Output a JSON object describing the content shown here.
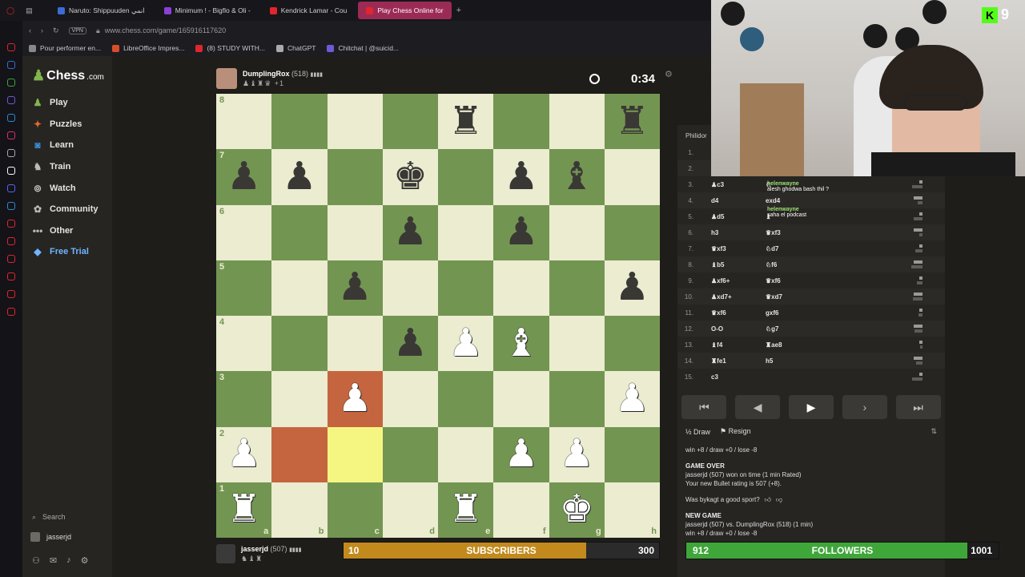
{
  "browser": {
    "tabs": [
      {
        "label": "Naruto: Shippuuden انمي",
        "color": "#3b6bd6"
      },
      {
        "label": "Minimum ! - Bigflo & Oli -",
        "color": "#8b3fd9"
      },
      {
        "label": "Kendrick Lamar - Cou",
        "color": "#e0262d"
      },
      {
        "label": "Play Chess Online for",
        "color": "#e0262d",
        "active": true
      }
    ],
    "vpn": "VPN",
    "url": "www.chess.com/game/165916117620",
    "bookmarks": [
      {
        "label": "Pour performer en...",
        "color": "#888"
      },
      {
        "label": "LibreOffice Impres...",
        "color": "#d94e2a"
      },
      {
        "label": "(8) STUDY WITH...",
        "color": "#e0262d"
      },
      {
        "label": "ChatGPT",
        "color": "#aaa"
      },
      {
        "label": "Chitchat | @suicid...",
        "color": "#6c5bd6"
      }
    ]
  },
  "sidebar": {
    "brand": "Chess",
    "brand_domain": ".com",
    "items": [
      {
        "label": "Play",
        "icon": "pawn-icon",
        "glyph": "♟"
      },
      {
        "label": "Puzzles",
        "icon": "puzzle-icon",
        "glyph": "✦"
      },
      {
        "label": "Learn",
        "icon": "learn-icon",
        "glyph": "◙"
      },
      {
        "label": "Train",
        "icon": "train-icon",
        "glyph": "♞"
      },
      {
        "label": "Watch",
        "icon": "binoculars-icon",
        "glyph": "⊚"
      },
      {
        "label": "Community",
        "icon": "community-icon",
        "glyph": "✿"
      },
      {
        "label": "Other",
        "icon": "more-icon",
        "glyph": "•••"
      },
      {
        "label": "Free Trial",
        "icon": "diamond-icon",
        "glyph": "◆"
      }
    ],
    "search_label": "Search",
    "username": "jasserjd"
  },
  "top_player": {
    "name": "DumplingRox",
    "rating": "(518)",
    "flag": "▮▮▮▮",
    "captured": "♟♝♜♛ +1"
  },
  "clock": {
    "time": "0:34"
  },
  "bottom_player": {
    "name": "jasserjd",
    "rating": "(507)",
    "flag": "▮▮▮▮",
    "captured": "♞♝♜"
  },
  "board": {
    "ranks": [
      "8",
      "7",
      "6",
      "5",
      "4",
      "3",
      "2",
      "1"
    ],
    "files": [
      "a",
      "b",
      "c",
      "d",
      "e",
      "f",
      "g",
      "h"
    ],
    "position": [
      [
        "",
        "",
        "",
        "",
        "r",
        "",
        "",
        "r"
      ],
      [
        "p",
        "p",
        "",
        "k",
        "",
        "p",
        "b",
        ""
      ],
      [
        "",
        "",
        "",
        "p",
        "",
        "p",
        "",
        ""
      ],
      [
        "",
        "",
        "p",
        "",
        "",
        "",
        "",
        "p"
      ],
      [
        "",
        "",
        "",
        "p",
        "P",
        "B",
        "",
        ""
      ],
      [
        "",
        "",
        "P",
        "",
        "",
        "",
        "",
        "P"
      ],
      [
        "P",
        "",
        "",
        "",
        "",
        "P",
        "P",
        ""
      ],
      [
        "R",
        "",
        "",
        "",
        "R",
        "",
        "K",
        ""
      ]
    ],
    "highlights": {
      "b2": "red",
      "c2": "yellow",
      "c3": "red"
    }
  },
  "subs_bar": {
    "start": "10",
    "label": "SUBSCRIBERS",
    "goal": "300",
    "progress": 0.77
  },
  "followers_bar": {
    "start": "912",
    "label": "FOLLOWERS",
    "goal": "1001",
    "progress": 0.9
  },
  "move_panel": {
    "opening": "Philidor",
    "moves": [
      {
        "n": "1.",
        "w": "",
        "b": ""
      },
      {
        "n": "2.",
        "w": "",
        "b": ""
      },
      {
        "n": "3.",
        "w": "♟c3",
        "b": "♘"
      },
      {
        "n": "4.",
        "w": "d4",
        "b": "exd4"
      },
      {
        "n": "5.",
        "w": "♟d5",
        "b": "♝"
      },
      {
        "n": "6.",
        "w": "h3",
        "b": "♛xf3"
      },
      {
        "n": "7.",
        "w": "♛xf3",
        "b": "♘d7"
      },
      {
        "n": "8.",
        "w": "♝b5",
        "b": "♘f6"
      },
      {
        "n": "9.",
        "w": "♟xf6+",
        "b": "♛xf6"
      },
      {
        "n": "10.",
        "w": "♟xd7+",
        "b": "♛xd7"
      },
      {
        "n": "11.",
        "w": "♛xf6",
        "b": "gxf6"
      },
      {
        "n": "12.",
        "w": "O-O",
        "b": "♘g7"
      },
      {
        "n": "13.",
        "w": "♝f4",
        "b": "♜ae8"
      },
      {
        "n": "14.",
        "w": "♜fe1",
        "b": "h5"
      },
      {
        "n": "15.",
        "w": "c3",
        "b": ""
      }
    ],
    "chat": [
      {
        "user": "helenwayne",
        "msg": "alesh ghodwa bash thil ?"
      },
      {
        "user": "helenwayne",
        "msg": "saha el podcast"
      }
    ],
    "draw_label": "Draw",
    "resign_label": "Resign",
    "log": {
      "line1": "win +8 / draw +0 / lose -8",
      "game_over": "GAME OVER",
      "result": "jasserjd (507) won on time (1 min Rated)",
      "new_rating": "Your new Bullet rating is 507 (+8).",
      "sport_q": "Was bykagt a good sport?",
      "new_game": "NEW GAME",
      "matchup": "jasserjd (507) vs. DumplingRox (518) (1 min)",
      "line2": "win +8 / draw +0 / lose -8"
    }
  },
  "overlay": {
    "kick_count": "9",
    "kick_logo": "K"
  }
}
